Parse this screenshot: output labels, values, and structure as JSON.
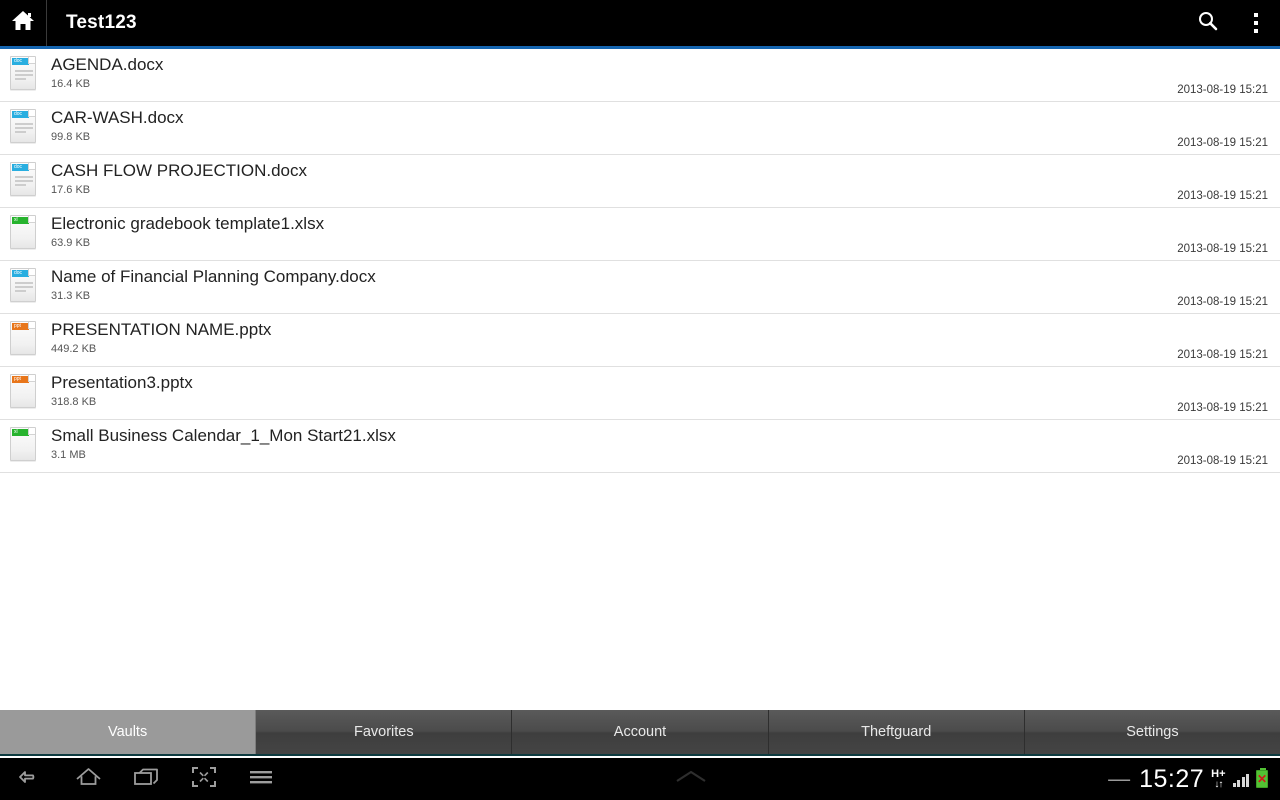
{
  "actionbar": {
    "home_icon": "home-icon",
    "title": "Test123",
    "search_icon": "search-icon",
    "overflow_icon": "overflow-menu-icon",
    "accent_color": "#1565b0"
  },
  "files": [
    {
      "name": "AGENDA.docx",
      "size": "16.4 KB",
      "date": "2013-08-19 15:21",
      "type": "docx",
      "tag": "doc",
      "color": "#29aee0"
    },
    {
      "name": "CAR-WASH.docx",
      "size": "99.8 KB",
      "date": "2013-08-19 15:21",
      "type": "docx",
      "tag": "doc",
      "color": "#29aee0"
    },
    {
      "name": "CASH FLOW PROJECTION.docx",
      "size": "17.6 KB",
      "date": "2013-08-19 15:21",
      "type": "docx",
      "tag": "doc",
      "color": "#29aee0"
    },
    {
      "name": "Electronic gradebook template1.xlsx",
      "size": "63.9 KB",
      "date": "2013-08-19 15:21",
      "type": "xlsx",
      "tag": "xl",
      "color": "#27b32e"
    },
    {
      "name": "Name of Financial Planning Company.docx",
      "size": "31.3 KB",
      "date": "2013-08-19 15:21",
      "type": "docx",
      "tag": "doc",
      "color": "#29aee0"
    },
    {
      "name": "PRESENTATION  NAME.pptx",
      "size": "449.2 KB",
      "date": "2013-08-19 15:21",
      "type": "pptx",
      "tag": "ppt",
      "color": "#e8761b"
    },
    {
      "name": "Presentation3.pptx",
      "size": "318.8 KB",
      "date": "2013-08-19 15:21",
      "type": "pptx",
      "tag": "ppt",
      "color": "#e8761b"
    },
    {
      "name": "Small Business Calendar_1_Mon Start21.xlsx",
      "size": "3.1 MB",
      "date": "2013-08-19 15:21",
      "type": "xlsx",
      "tag": "xl",
      "color": "#27b32e"
    }
  ],
  "tabs": [
    {
      "label": "Vaults",
      "active": true
    },
    {
      "label": "Favorites",
      "active": false
    },
    {
      "label": "Account",
      "active": false
    },
    {
      "label": "Theftguard",
      "active": false
    },
    {
      "label": "Settings",
      "active": false
    }
  ],
  "navbar": {
    "back_icon": "back-icon",
    "home_icon": "home-icon",
    "recents_icon": "recent-apps-icon",
    "screenshot_icon": "screen-capture-icon",
    "menu_icon": "menu-icon",
    "expand_icon": "chevron-up-icon",
    "minimize_label": "—",
    "clock": "15:27",
    "network_type": "H+",
    "network_arrows": "↓↑",
    "signal_icon": "signal-bars-icon",
    "battery_icon": "battery-error-icon",
    "battery_color": "#52c234"
  }
}
